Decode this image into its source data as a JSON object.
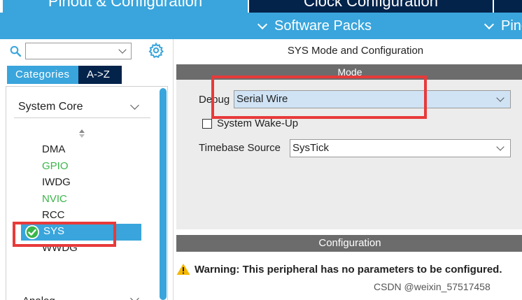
{
  "top_tabs": [
    {
      "label": "Pinout & Configuration"
    },
    {
      "label": "Clock Configuration"
    }
  ],
  "sub_bar": {
    "software_packs": "Software Packs",
    "pinout": "Pinout"
  },
  "search": {
    "value": "",
    "placeholder": ""
  },
  "left_tabs": {
    "categories": "Categories",
    "az": "A->Z"
  },
  "tree": {
    "group": "System Core",
    "items": [
      {
        "label": "DMA",
        "status": "none"
      },
      {
        "label": "GPIO",
        "status": "configured"
      },
      {
        "label": "IWDG",
        "status": "none"
      },
      {
        "label": "NVIC",
        "status": "configured"
      },
      {
        "label": "RCC",
        "status": "none"
      },
      {
        "label": "SYS",
        "status": "selected"
      },
      {
        "label": "WWDG",
        "status": "none"
      }
    ],
    "next_group": "Analog"
  },
  "panel": {
    "title": "SYS Mode and Configuration",
    "mode_header": "Mode",
    "debug_label": "Debug",
    "debug_value": "Serial Wire",
    "wakeup_label": "System Wake-Up",
    "wakeup_checked": false,
    "timebase_label": "Timebase Source",
    "timebase_value": "SysTick",
    "config_header": "Configuration",
    "warning": "Warning: This peripheral has no parameters to be configured."
  },
  "watermark": "CSDN @weixin_57517458",
  "colors": {
    "accent_blue": "#39a5dc",
    "navy": "#03234b",
    "configured_green": "#3bb54a",
    "header_gray": "#6c6c6c",
    "highlight_red": "#e83a3a",
    "warning_yellow": "#f5b800"
  },
  "icons": {
    "search": "search-icon",
    "gear": "gear-icon",
    "check": "check-circle-icon",
    "warning": "warning-icon"
  }
}
